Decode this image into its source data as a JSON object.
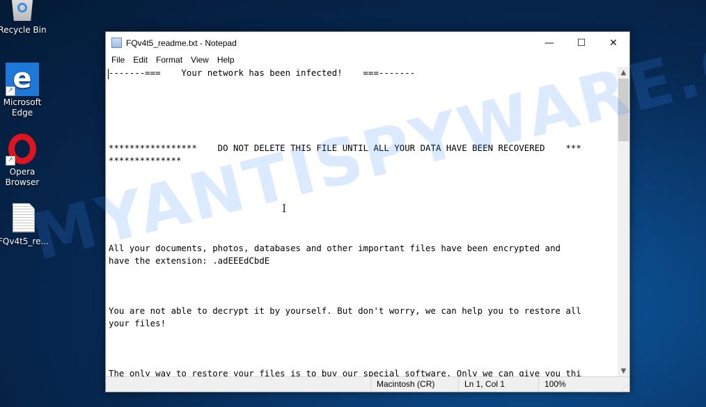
{
  "desktop": {
    "icons": [
      {
        "label": "Recycle Bin",
        "icon": "recycle-bin-icon"
      },
      {
        "label": "Microsoft Edge",
        "icon": "edge-icon"
      },
      {
        "label": "Opera Browser",
        "icon": "opera-icon"
      },
      {
        "label": "FQv4t5_re...",
        "icon": "text-file-icon"
      }
    ],
    "watermark": "MYANTISPYWARE.COM"
  },
  "window": {
    "title": "FQv4t5_readme.txt - Notepad",
    "controls": {
      "minimize": "—",
      "maximize": "☐",
      "close": "✕"
    },
    "menu": [
      "File",
      "Edit",
      "Format",
      "View",
      "Help"
    ],
    "content": "-------===    Your network has been infected!    ===-------\n\n\n\n\n\n*****************    DO NOT DELETE THIS FILE UNTIL ALL YOUR DATA HAVE BEEN RECOVERED    ***\n**************\n\n\n\n\n\n\nAll your documents, photos, databases and other important files have been encrypted and\nhave the extension: .adEEEdCbdE\n\n\n\nYou are not able to decrypt it by yourself. But don't worry, we can help you to restore all\nyour files!\n\n\n\nThe only way to restore your files is to buy our special software. Only we can give you thi\ns software and only we can restore your files!",
    "status": {
      "line_ending": "Macintosh (CR)",
      "position": "Ln 1, Col 1",
      "zoom": "100%"
    }
  }
}
